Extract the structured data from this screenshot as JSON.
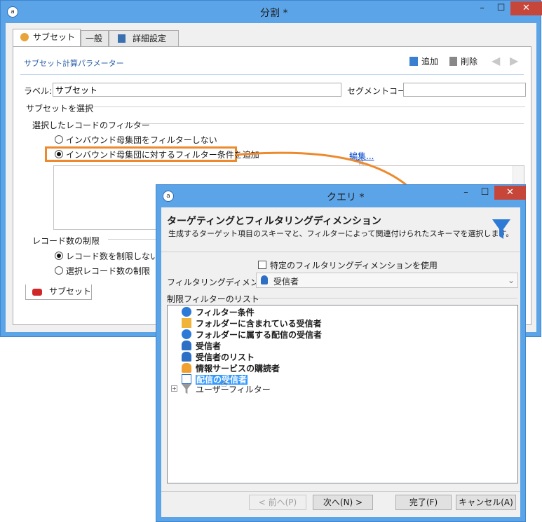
{
  "main_window": {
    "title": "分割 *",
    "tabs": [
      {
        "label": "サブセット"
      },
      {
        "label": "一般"
      },
      {
        "label": "詳細設定"
      }
    ],
    "section_title": "サブセット計算パラメーター",
    "toolbar": {
      "add_label": "追加",
      "delete_label": "削除"
    },
    "label_field": {
      "label": "ラベル:",
      "value": "サブセット"
    },
    "segment_code": {
      "label": "セグメントコード:",
      "value": ""
    },
    "select_subset_group": "サブセットを選択",
    "filter_group": "選択したレコードのフィルター",
    "filter_options": [
      {
        "label": "インバウンド母集団をフィルターしない",
        "selected": false
      },
      {
        "label": "インバウンド母集団に対するフィルター条件を追加",
        "selected": true
      }
    ],
    "edit_link": "編集...",
    "limit_group": "レコード数の制限",
    "limit_options": [
      {
        "label": "レコード数を制限しない",
        "selected": true
      },
      {
        "label": "選択レコード数の制限",
        "selected": false
      }
    ],
    "bottom_tab": "サブセット"
  },
  "query_dialog": {
    "title": "クエリ *",
    "heading": "ターゲティングとフィルタリングディメンション",
    "description": "生成するターゲット項目のスキーマと、フィルターによって関連付けられたスキーマを選択します。",
    "checkbox_label": "特定のフィルタリングディメンションを使用",
    "checkbox_checked": false,
    "dimension_label": "フィルタリングディメンション:",
    "dimension_value": "受信者",
    "list_title": "制限フィルターのリスト",
    "list_items": [
      {
        "label": "フィルター条件",
        "icon": "filter-conditions-icon"
      },
      {
        "label": "フォルダーに含まれている受信者",
        "icon": "folder-recipient-icon"
      },
      {
        "label": "フォルダーに属する配信の受信者",
        "icon": "delivery-folder-icon"
      },
      {
        "label": "受信者",
        "icon": "recipient-icon"
      },
      {
        "label": "受信者のリスト",
        "icon": "recipient-list-icon"
      },
      {
        "label": "情報サービスの購読者",
        "icon": "subscriber-icon"
      },
      {
        "label": "配信の受信者",
        "icon": "envelope-icon",
        "selected": true
      },
      {
        "label": "ユーザーフィルター",
        "icon": "user-filter-icon",
        "expandable": true
      }
    ],
    "buttons": {
      "prev": "< 前へ(P)",
      "next": "次へ(N) >",
      "finish": "完了(F)",
      "cancel": "キャンセル(A)"
    }
  },
  "colors": {
    "title_bar": "#5ba4e8",
    "highlight": "#ee8a2e",
    "selection": "#3399ff",
    "link": "#0044cc",
    "close": "#c7463a"
  }
}
